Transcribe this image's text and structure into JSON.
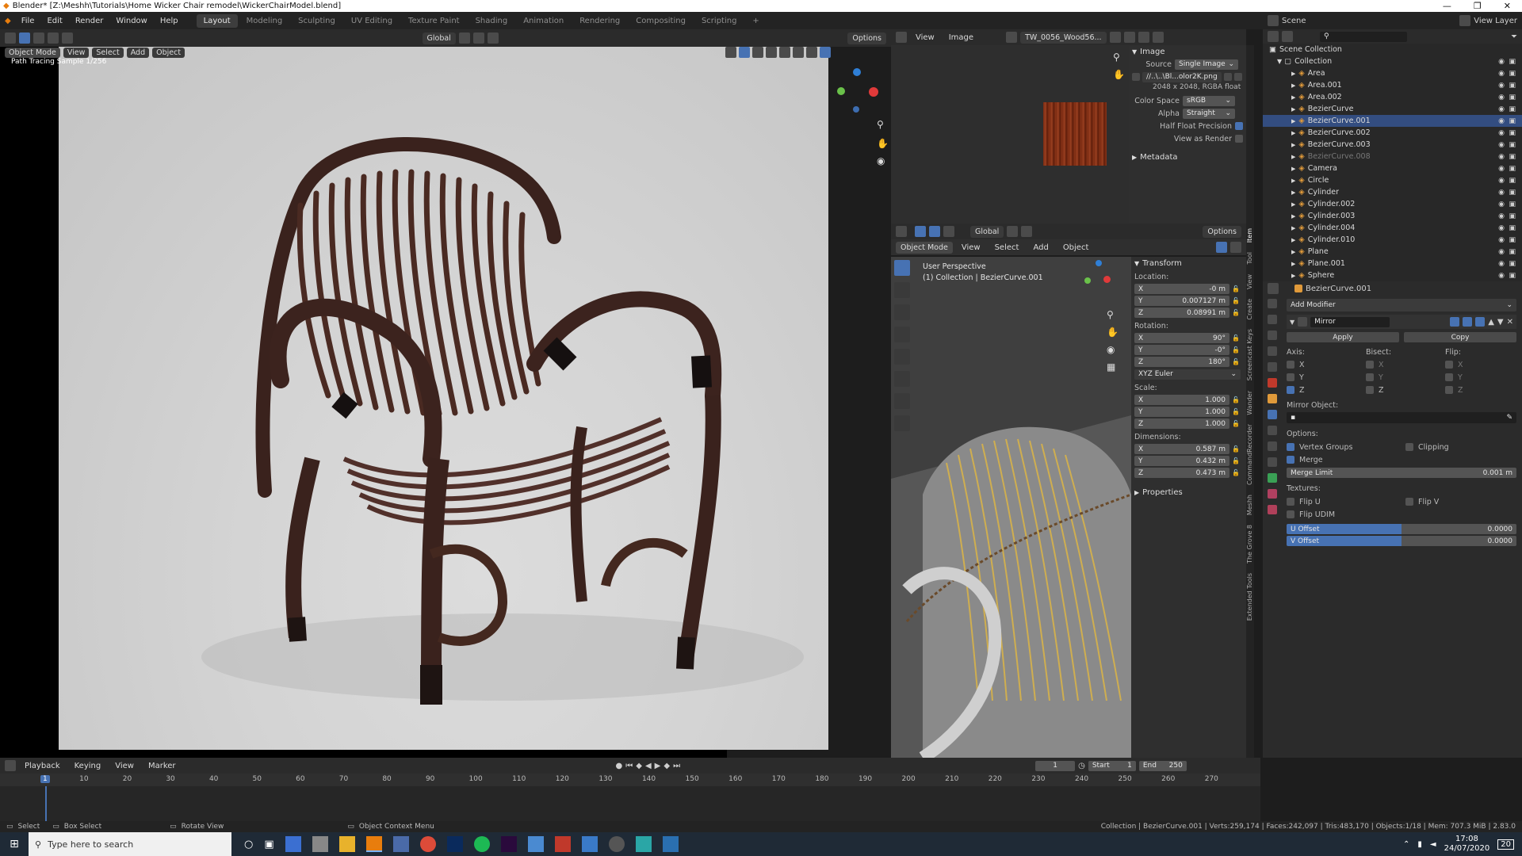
{
  "window": {
    "title": "Blender* [Z:\\Meshh\\Tutorials\\Home Wicker Chair remodel\\WickerChairModel.blend]",
    "controls": [
      "—",
      "❐",
      "✕"
    ]
  },
  "menu": [
    "File",
    "Edit",
    "Render",
    "Window",
    "Help"
  ],
  "workspaces": [
    "Layout",
    "Modeling",
    "Sculpting",
    "UV Editing",
    "Texture Paint",
    "Shading",
    "Animation",
    "Rendering",
    "Compositing",
    "Scripting",
    "+"
  ],
  "active_workspace": "Layout",
  "render_view": {
    "mode": "Object Mode",
    "menus": [
      "View",
      "Select",
      "Add",
      "Object"
    ],
    "transform": "Global",
    "options": "Options",
    "overlay_text": "Path Tracing Sample 1/256"
  },
  "image_editor": {
    "menus": [
      "View",
      "Image"
    ],
    "image_name": "TW_0056_Wood56...",
    "section_image": "Image",
    "source_label": "Source",
    "source_value": "Single Image",
    "filepath": "//..\\..\\Bl...olor2K.png",
    "info": "2048 x 2048,  RGBA float",
    "color_space_label": "Color Space",
    "color_space_value": "sRGB",
    "alpha_label": "Alpha",
    "alpha_value": "Straight",
    "half_float_label": "Half Float Precision",
    "view_as_render_label": "View as Render",
    "metadata_label": "Metadata"
  },
  "viewport3d": {
    "mode": "Object Mode",
    "menus": [
      "View",
      "Select",
      "Add",
      "Object"
    ],
    "transform": "Global",
    "options": "Options",
    "perspective": "User Perspective",
    "collection_info": "(1) Collection | BezierCurve.001",
    "side_tabs": [
      "Item",
      "Tool",
      "View",
      "Create",
      "Screencast Keys",
      "Wander",
      "CommandRecorder",
      "Meshh",
      "The Grove 8",
      "Extended Tools"
    ]
  },
  "n_panel": {
    "transform_label": "Transform",
    "location_label": "Location:",
    "location": [
      {
        "axis": "X",
        "value": "-0 m"
      },
      {
        "axis": "Y",
        "value": "0.007127 m"
      },
      {
        "axis": "Z",
        "value": "0.08991 m"
      }
    ],
    "rotation_label": "Rotation:",
    "rotation": [
      {
        "axis": "X",
        "value": "90°"
      },
      {
        "axis": "Y",
        "value": "-0°"
      },
      {
        "axis": "Z",
        "value": "180°"
      }
    ],
    "rotation_mode": "XYZ Euler",
    "scale_label": "Scale:",
    "scale": [
      {
        "axis": "X",
        "value": "1.000"
      },
      {
        "axis": "Y",
        "value": "1.000"
      },
      {
        "axis": "Z",
        "value": "1.000"
      }
    ],
    "dimensions_label": "Dimensions:",
    "dimensions": [
      {
        "axis": "X",
        "value": "0.587 m"
      },
      {
        "axis": "Y",
        "value": "0.432 m"
      },
      {
        "axis": "Z",
        "value": "0.473 m"
      }
    ],
    "properties_label": "Properties"
  },
  "outliner": {
    "scene_label": "Scene",
    "view_layer_label": "View Layer",
    "root": "Scene Collection",
    "collection": "Collection",
    "items": [
      {
        "name": "Area",
        "selected": false
      },
      {
        "name": "Area.001",
        "selected": false
      },
      {
        "name": "Area.002",
        "selected": false
      },
      {
        "name": "BezierCurve",
        "selected": false
      },
      {
        "name": "BezierCurve.001",
        "selected": true
      },
      {
        "name": "BezierCurve.002",
        "selected": false
      },
      {
        "name": "BezierCurve.003",
        "selected": false
      },
      {
        "name": "BezierCurve.008",
        "selected": false
      },
      {
        "name": "Camera",
        "selected": false
      },
      {
        "name": "Circle",
        "selected": false
      },
      {
        "name": "Cylinder",
        "selected": false
      },
      {
        "name": "Cylinder.002",
        "selected": false
      },
      {
        "name": "Cylinder.003",
        "selected": false
      },
      {
        "name": "Cylinder.004",
        "selected": false
      },
      {
        "name": "Cylinder.010",
        "selected": false
      },
      {
        "name": "Plane",
        "selected": false
      },
      {
        "name": "Plane.001",
        "selected": false
      },
      {
        "name": "Sphere",
        "selected": false
      }
    ]
  },
  "properties": {
    "object_name": "BezierCurve.001",
    "add_modifier": "Add Modifier",
    "modifier_name": "Mirror",
    "apply": "Apply",
    "copy": "Copy",
    "axis_label": "Axis:",
    "bisect_label": "Bisect:",
    "flip_label": "Flip:",
    "axes": [
      "X",
      "Y",
      "Z"
    ],
    "mirror_object_label": "Mirror Object:",
    "options_label": "Options:",
    "vertex_groups": "Vertex Groups",
    "clipping": "Clipping",
    "merge": "Merge",
    "merge_limit_label": "Merge Limit",
    "merge_limit_value": "0.001 m",
    "textures_label": "Textures:",
    "flip_u": "Flip U",
    "flip_v": "Flip V",
    "flip_udim": "Flip UDIM",
    "u_offset_label": "U Offset",
    "u_offset_value": "0.0000",
    "v_offset_label": "V Offset",
    "v_offset_value": "0.0000"
  },
  "timeline": {
    "menus": [
      "Playback",
      "Keying",
      "View",
      "Marker"
    ],
    "current_frame": "1",
    "start_label": "Start",
    "start_value": "1",
    "end_label": "End",
    "end_value": "250",
    "ticks": [
      "1",
      "10",
      "20",
      "30",
      "40",
      "50",
      "60",
      "70",
      "80",
      "90",
      "100",
      "110",
      "120",
      "130",
      "140",
      "150",
      "160",
      "170",
      "180",
      "190",
      "200",
      "210",
      "220",
      "230",
      "240",
      "250",
      "260",
      "270"
    ]
  },
  "statusbar": {
    "select": "Select",
    "box_select": "Box Select",
    "rotate_view": "Rotate View",
    "context_menu": "Object Context Menu",
    "stats": "Collection | BezierCurve.001 | Verts:259,174 | Faces:242,097 | Tris:483,170 | Objects:1/18 | Mem: 707.3 MiB | 2.83.0"
  },
  "taskbar": {
    "search_placeholder": "Type here to search",
    "time": "17:08",
    "date": "24/07/2020",
    "notification_count": "20"
  },
  "colors": {
    "accent": "#4772b3",
    "selection": "#334d80",
    "wicker_brown": "#4a2a22"
  }
}
